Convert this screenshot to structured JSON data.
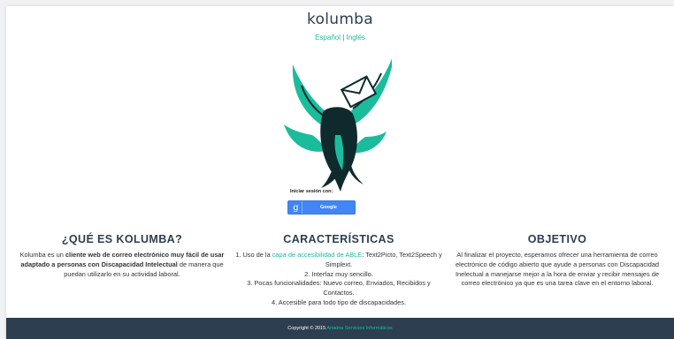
{
  "header": {
    "logo": "kolumba",
    "lang_spanish": "Español",
    "lang_separator": " | ",
    "lang_english": "Inglés"
  },
  "login": {
    "label": "Iniciar sesión con:",
    "google_icon_glyph": "g",
    "google_label": "Google"
  },
  "about": {
    "title": "¿QUÉ ES KOLUMBA?",
    "p_start": "Kolumba es un ",
    "p_bold1": "cliente web de correo electrónico muy fácil de usar adaptado a personas con Discapacidad Intelectual",
    "p_end": " de manera que puedan utilizarlo en su actividad laboral."
  },
  "features": {
    "title": "CARACTERÍSTICAS",
    "item1_start": "1. Uso de la ",
    "item1_link": "capa de accesibilidad de ABLE",
    "item1_end": ": Text2Picto, Text2Speech y Simplext.",
    "item2": "2. Interfaz muy sencillo.",
    "item3": "3. Pocas funcionalidades: Nuevo correo, Enviados, Recibidos y Contactos.",
    "item4": "4. Accesible para todo tipo de discapacidades."
  },
  "objective": {
    "title": "OBJETIVO",
    "text": "Al finalizar el proyecto, esperamos ofrecer una herramienta de correo electrónico de código abierto que ayude a personas con Discapacidad Inelectual a manejarse mejor a la hora de enviar y recibir mensajes de correo electrónico ya que es una tarea clave en el entorno laboral."
  },
  "footer": {
    "copyright": "Copyright © 2015 ",
    "company": "Ariadna Servicios Informáticos"
  },
  "colors": {
    "teal": "#1abc9c",
    "bird_dark": "#0f2a2d",
    "footer_bg": "#2c3e50",
    "google_blue": "#4285f4"
  }
}
